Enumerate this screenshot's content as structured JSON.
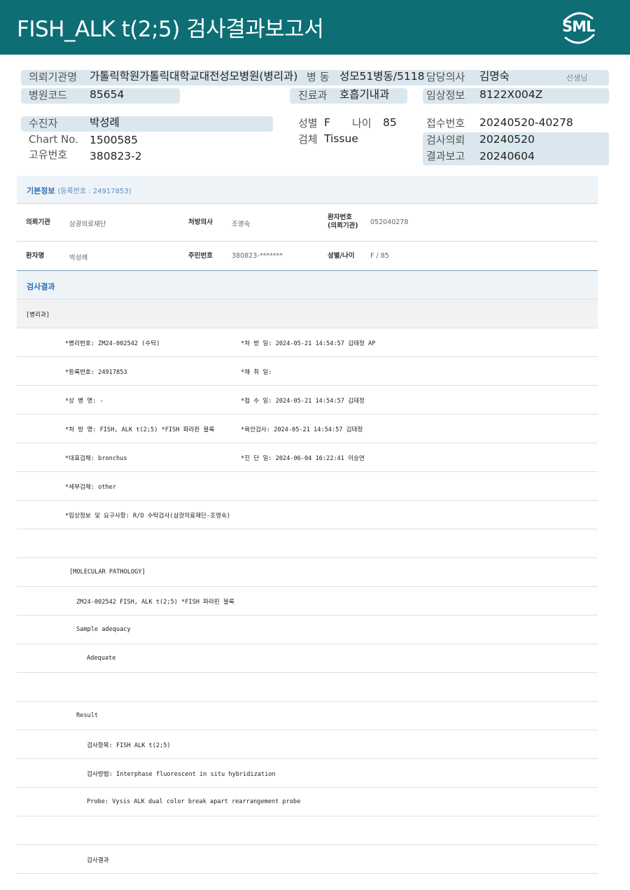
{
  "header": {
    "title": "FISH_ALK  t(2;5) 검사결과보고서",
    "logo_text": "SML"
  },
  "summary": {
    "institution_label": "의뢰기관명",
    "institution_value": "가톨릭학원가톨릭대학교대전성모병원(병리과)",
    "ward_label": "병 동",
    "ward_value": "성모51병동/5118",
    "doctor_label": "담당의사",
    "doctor_value": "김명숙",
    "doctor_suffix": "선생님",
    "hospital_code_label": "병원코드",
    "hospital_code_value": "85654",
    "dept_label": "진료과",
    "dept_value": "호흡기내과",
    "clinical_label": "임상정보",
    "clinical_value": "8122X004Z",
    "patient_label": "수진자",
    "patient_value": "박성례",
    "sex_label": "성별",
    "sex_value": "F",
    "age_label": "나이",
    "age_value": "85",
    "receipt_no_label": "접수번호",
    "receipt_no_value": "20240520-40278",
    "chart_no_label": "Chart No.",
    "chart_no_value": "1500585",
    "specimen_label": "검체",
    "specimen_value": "Tissue",
    "request_label": "검사의뢰",
    "request_value": "20240520",
    "unique_no_label": "고유번호",
    "unique_no_value": "380823-2",
    "report_label": "결과보고",
    "report_value": "20240604"
  },
  "basic_info": {
    "title": "기본정보",
    "reg_no_text": "(등록번호 : 24917853)",
    "inst_label": "의뢰기관",
    "inst_value": "삼광의료재단",
    "prescriber_label": "처방의사",
    "prescriber_value": "조영숙",
    "patient_no_label_1": "환자번호",
    "patient_no_label_2": "(의뢰기관)",
    "patient_no_value": "052040278",
    "name_label": "환자명",
    "name_value": "박성례",
    "rrn_label": "주민번호",
    "rrn_value": "380823-*******",
    "sexage_label": "성별/나이",
    "sexage_value": "F / 85"
  },
  "results": {
    "title": "검사결과",
    "dept_tag": "[병리과]",
    "lines": [
      {
        "left": "*병리번호: ZM24-002542 (수탁)",
        "right": "*처 방 일: 2024-05-21 14:54:57  김태정 AP"
      },
      {
        "left": "*등록번호: 24917853",
        "right": "*채 취 일:"
      },
      {
        "left": "*상 병 명: -",
        "right": "*접 수 일: 2024-05-21 14:54:57  김태정"
      },
      {
        "left": "*처 방 명: FISH, ALK t(2;5) *FISH 파라핀 블록",
        "right": "*육안검사: 2024-05-21 14:54:57  김태정"
      },
      {
        "left": "*대표검체: bronchus",
        "right": "*진 단 일: 2024-06-04 16:22:41  이승연"
      },
      {
        "left": "*세부검체: other",
        "right": ""
      },
      {
        "left": "*임상정보 및 요구사항: R/O 수탁검사(삼광의료재단-조영숙)",
        "right": ""
      }
    ],
    "mol_header": "[MOLECULAR PATHOLOGY]",
    "case_line": "ZM24-002542    FISH, ALK t(2;5) *FISH 파라핀 블록",
    "sample_adequacy": "Sample adequacy",
    "adequate": "Adequate",
    "result_label": "Result",
    "test_item": "검사항목: FISH ALK t(2;5)",
    "test_method": "검사방법: Interphase fluorescent in situ hybridization",
    "probe": "Probe: Vysis ALK dual color break apart rearrangement probe",
    "test_result": "검사결과"
  }
}
